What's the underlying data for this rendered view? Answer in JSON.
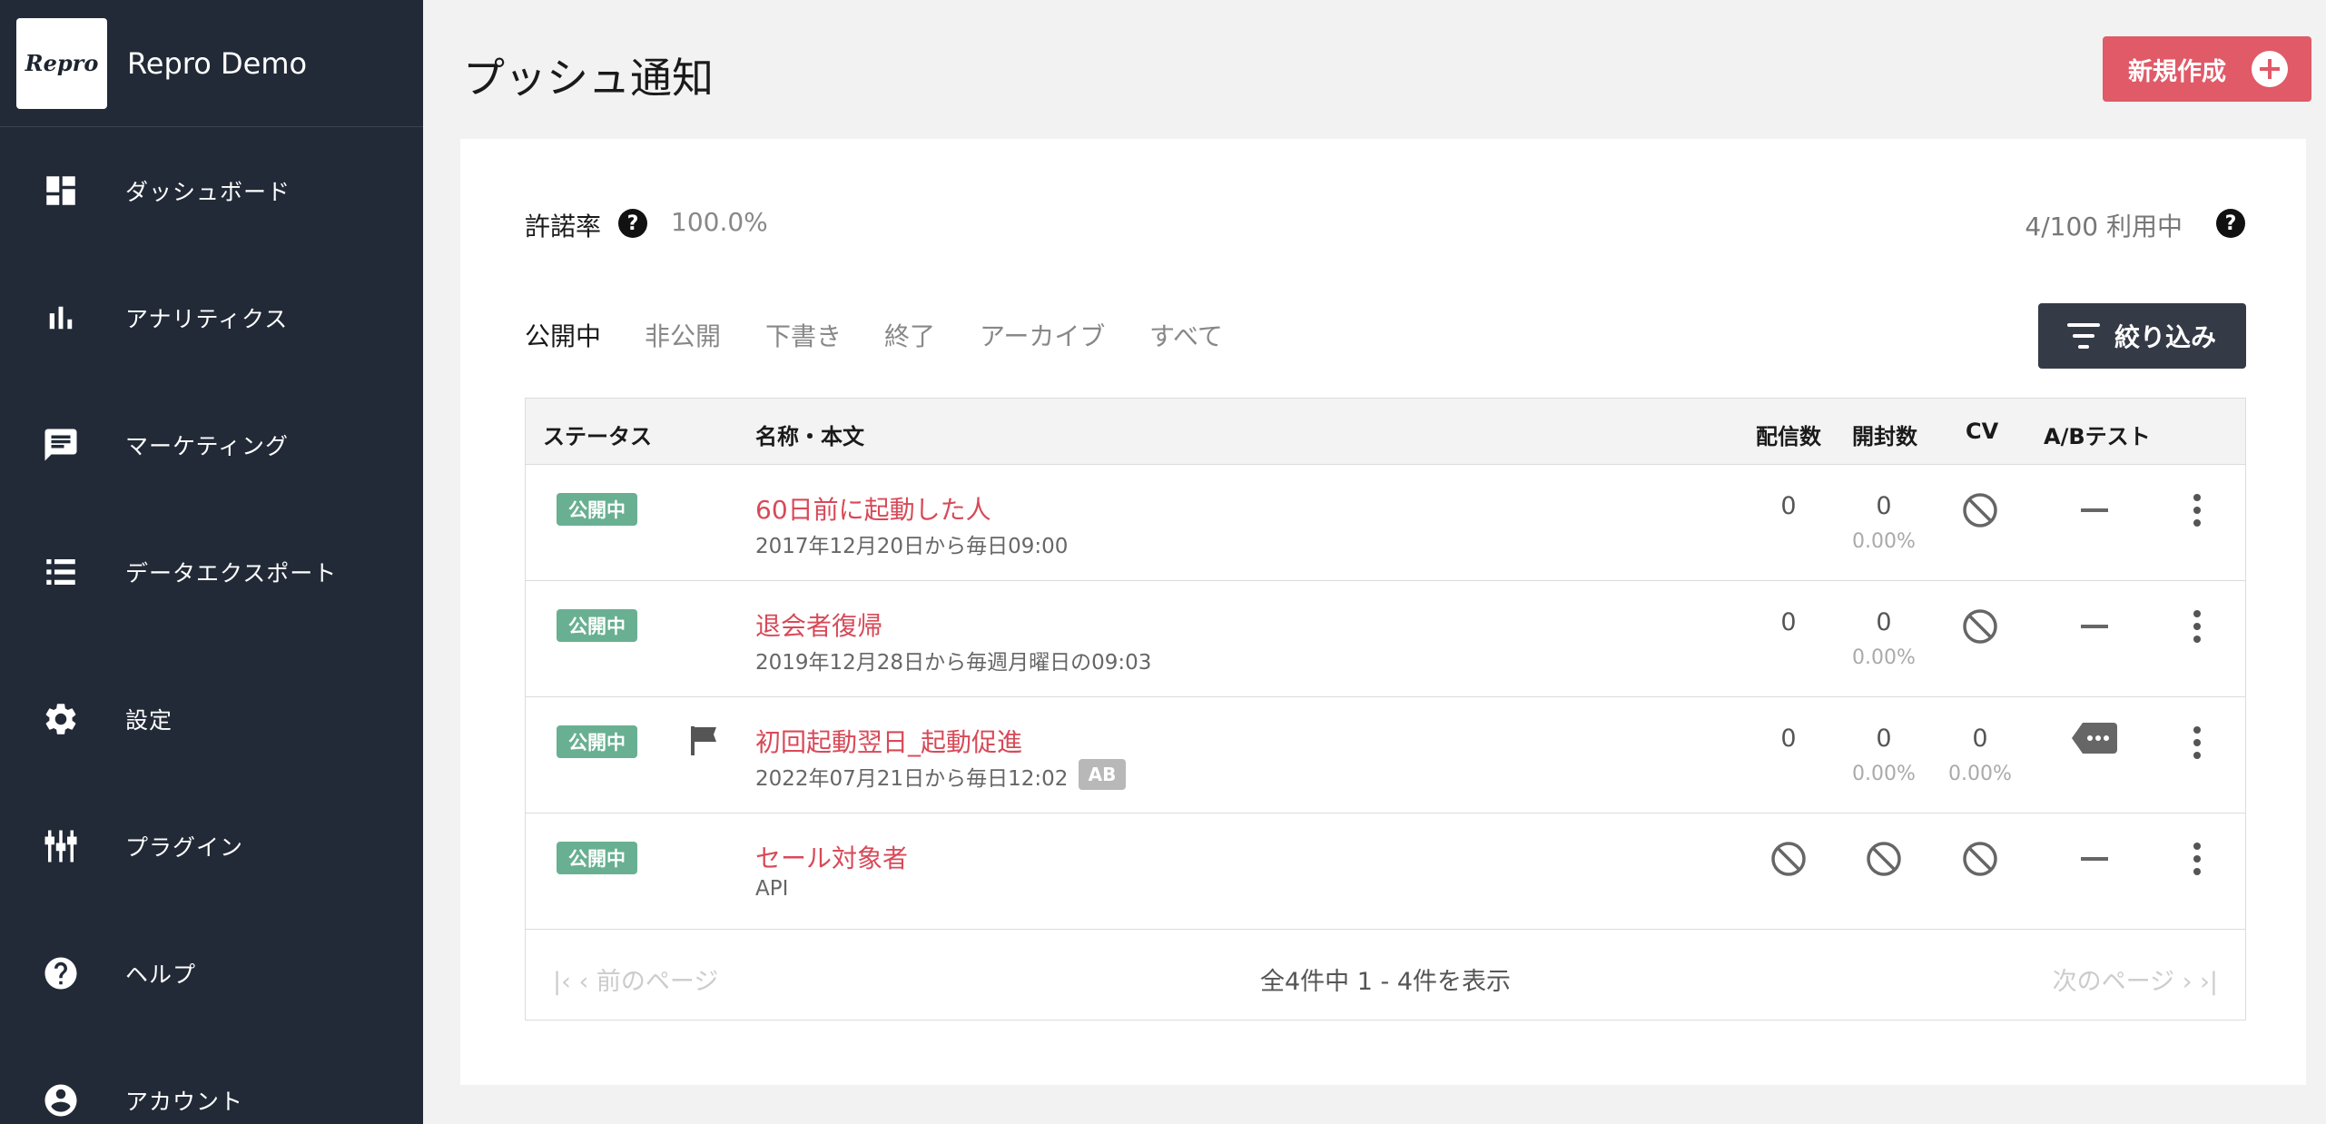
{
  "sidebar": {
    "logo_text": "Repro",
    "app_name": "Repro Demo",
    "items": [
      {
        "label": "ダッシュボード",
        "icon": "dashboard-icon"
      },
      {
        "label": "アナリティクス",
        "icon": "bar-chart-icon"
      },
      {
        "label": "マーケティング",
        "icon": "chat-icon"
      },
      {
        "label": "データエクスポート",
        "icon": "list-icon"
      },
      {
        "label": "設定",
        "icon": "gear-icon"
      },
      {
        "label": "プラグイン",
        "icon": "plugin-icon"
      },
      {
        "label": "ヘルプ",
        "icon": "help-icon"
      },
      {
        "label": "アカウント",
        "icon": "account-icon"
      }
    ]
  },
  "header": {
    "title": "プッシュ通知",
    "new_button_label": "新規作成"
  },
  "stats": {
    "accept_label": "許諾率",
    "accept_value": "100.0%",
    "usage": "4/100 利用中"
  },
  "tabs": [
    {
      "label": "公開中",
      "active": true
    },
    {
      "label": "非公開",
      "active": false
    },
    {
      "label": "下書き",
      "active": false
    },
    {
      "label": "終了",
      "active": false
    },
    {
      "label": "アーカイブ",
      "active": false
    },
    {
      "label": "すべて",
      "active": false
    }
  ],
  "filter_button_label": "絞り込み",
  "table": {
    "headers": {
      "status": "ステータス",
      "name": "名称・本文",
      "deliveries": "配信数",
      "opens": "開封数",
      "cv": "CV",
      "ab_test": "A/Bテスト"
    },
    "rows": [
      {
        "status": "公開中",
        "title": "60日前に起動した人",
        "subtitle": "2017年12月20日から毎日09:00",
        "deliveries": "0",
        "opens": "0",
        "opens_rate": "0.00%",
        "cv": null,
        "cv_rate": null,
        "ab": "dash",
        "flag": false,
        "ab_tag": null
      },
      {
        "status": "公開中",
        "title": "退会者復帰",
        "subtitle": "2019年12月28日から毎週月曜日の09:03",
        "deliveries": "0",
        "opens": "0",
        "opens_rate": "0.00%",
        "cv": null,
        "cv_rate": null,
        "ab": "dash",
        "flag": false,
        "ab_tag": null
      },
      {
        "status": "公開中",
        "title": "初回起動翌日_起動促進",
        "subtitle": "2022年07月21日から毎日12:02",
        "deliveries": "0",
        "opens": "0",
        "opens_rate": "0.00%",
        "cv": "0",
        "cv_rate": "0.00%",
        "ab": "tag",
        "flag": true,
        "ab_tag": "AB"
      },
      {
        "status": "公開中",
        "title": "セール対象者",
        "subtitle": "API",
        "deliveries": null,
        "opens": null,
        "opens_rate": null,
        "cv": null,
        "cv_rate": null,
        "ab": "dash",
        "flag": false,
        "ab_tag": null
      }
    ]
  },
  "pagination": {
    "summary": "全4件中 1 - 4件を表示",
    "prev_label": "前のページ",
    "next_label": "次のページ"
  },
  "colors": {
    "sidebar_bg": "#222a37",
    "accent": "#e05a68",
    "status_green": "#68b091",
    "link_red": "#d74a58"
  }
}
